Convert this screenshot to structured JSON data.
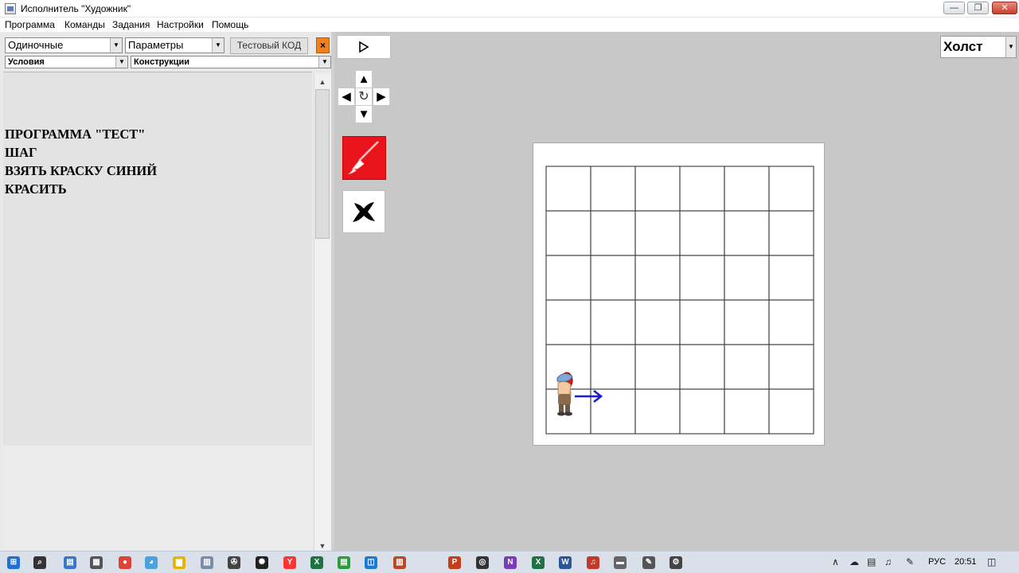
{
  "window": {
    "title": "Исполнитель \"Художник\""
  },
  "menu": [
    "Программа",
    "Команды",
    "Задания",
    "Настройки",
    "Помощь"
  ],
  "commands_panel": {
    "category_combo": "Одиночные",
    "parameters_combo": "Параметры",
    "conditions_combo": "Условия",
    "constructions_combo": "Конструкции",
    "test_code_button": "Тестовый КОД",
    "clear_button": "×"
  },
  "code": {
    "lines": [
      "ПРОГРАММА \"ТЕСТ\"",
      "ШАГ",
      "ВЗЯТЬ КРАСКУ СИНИЙ",
      "КРАСИТЬ"
    ]
  },
  "controls": {
    "run_icon": "play-icon",
    "directions": [
      "up",
      "left",
      "rotate",
      "right",
      "down"
    ],
    "brush_color": "#e8131b"
  },
  "canvas": {
    "selector_value": "Холст",
    "grid": {
      "rows": 6,
      "cols": 6
    },
    "robot": {
      "row": 6,
      "col": 1,
      "facing": "right",
      "paint_drop_color": "#e31212",
      "arrow_color": "#1a1adf"
    }
  },
  "taskbar": {
    "language": "РУС",
    "clock": "20:51",
    "pinned_icons": [
      "start-icon",
      "search-icon",
      "task-view-icon",
      "calculator-icon",
      "chrome-icon",
      "browser-icon",
      "file-explorer-icon",
      "network-icon",
      "painter-app-icon",
      "media-icon",
      "yandex-icon",
      "excel-icon",
      "tasks-icon",
      "store-icon",
      "project-icon",
      "powerpoint-icon",
      "target-icon",
      "onenote-icon",
      "excel-icon",
      "word-icon",
      "audio-icon",
      "ticket-icon",
      "tool-icon",
      "settings-icon"
    ]
  }
}
